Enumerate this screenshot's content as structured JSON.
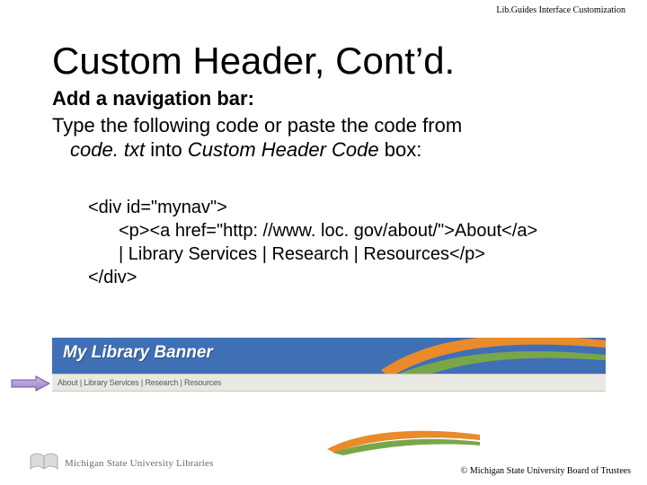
{
  "top_label": "Lib.Guides Interface Customization",
  "title": "Custom Header, Cont’d.",
  "body": {
    "line1": "Add a navigation bar:",
    "line2a": "Type the following code or paste the code from",
    "line2b_italic1": "code. txt",
    "line2b_mid": " into ",
    "line2b_italic2": "Custom Header Code",
    "line2b_end": " box:"
  },
  "code": {
    "l1": "<div id=\"mynav\">",
    "l2": "<p><a href=\"http: //www. loc. gov/about/\">About</a>",
    "l3": "| Library Services | Research | Resources</p>",
    "l4": "</div>"
  },
  "banner": {
    "text": "My Library Banner",
    "nav": "About | Library Services | Research | Resources"
  },
  "footer": {
    "org": "Michigan State University Libraries",
    "copyright": "© Michigan State University Board of Trustees"
  }
}
